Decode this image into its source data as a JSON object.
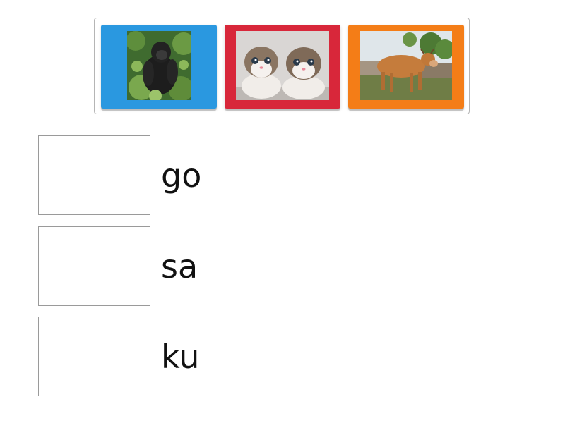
{
  "tray": {
    "cards": [
      {
        "picture": "gorilla",
        "color": "#2a98e0"
      },
      {
        "picture": "kittens",
        "color": "#d8273a"
      },
      {
        "picture": "cow",
        "color": "#f47d17"
      }
    ]
  },
  "rows": [
    {
      "label": "go"
    },
    {
      "label": "sa"
    },
    {
      "label": "ku"
    }
  ]
}
